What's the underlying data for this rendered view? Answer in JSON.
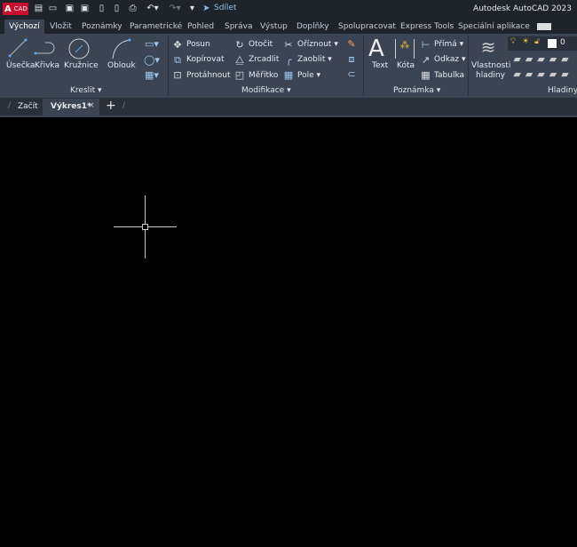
{
  "titlebar": {
    "logo": "A",
    "logo_sub": "CAD",
    "share": "Sdílet",
    "app_title": "Autodesk AutoCAD 2023",
    "quick_access": [
      "new-icon",
      "open-icon",
      "save-icon",
      "save-as-icon",
      "open-web-icon",
      "save-web-icon",
      "plot-icon",
      "undo-icon",
      "redo-icon",
      "customize-icon"
    ]
  },
  "ribbon_tabs": [
    "Výchozí",
    "Vložit",
    "Poznámky",
    "Parametrické",
    "Pohled",
    "Správa",
    "Výstup",
    "Doplňky",
    "Spolupracovat",
    "Express Tools",
    "Speciální aplikace"
  ],
  "active_tab": "Výchozí",
  "panels": {
    "kreslit": {
      "title": "Kreslit",
      "tools": [
        "Úsečka",
        "Křivka",
        "Kružnice",
        "Oblouk"
      ]
    },
    "modifikace": {
      "title": "Modifikace",
      "tools": [
        "Posun",
        "Kopírovat",
        "Protáhnout",
        "Otočit",
        "Zrcadlit",
        "Měřítko",
        "Oříznout",
        "Zaoblit",
        "Pole"
      ]
    },
    "poznamka": {
      "title": "Poznámka",
      "tools": [
        "Text",
        "Kóta",
        "Přímá",
        "Odkaz",
        "Tabulka"
      ]
    },
    "hladiny": {
      "title": "Hladiny",
      "tools": [
        "Vlastnosti",
        "hladiny"
      ],
      "current_layer": "0"
    }
  },
  "file_tabs": {
    "start": "Začít",
    "drawing": "Výkres1*",
    "add": "+"
  },
  "colors": {
    "ribbon": "#3b4453",
    "titlebar": "#1f242b",
    "canvas": "#000000",
    "accent": "#c8102e"
  }
}
